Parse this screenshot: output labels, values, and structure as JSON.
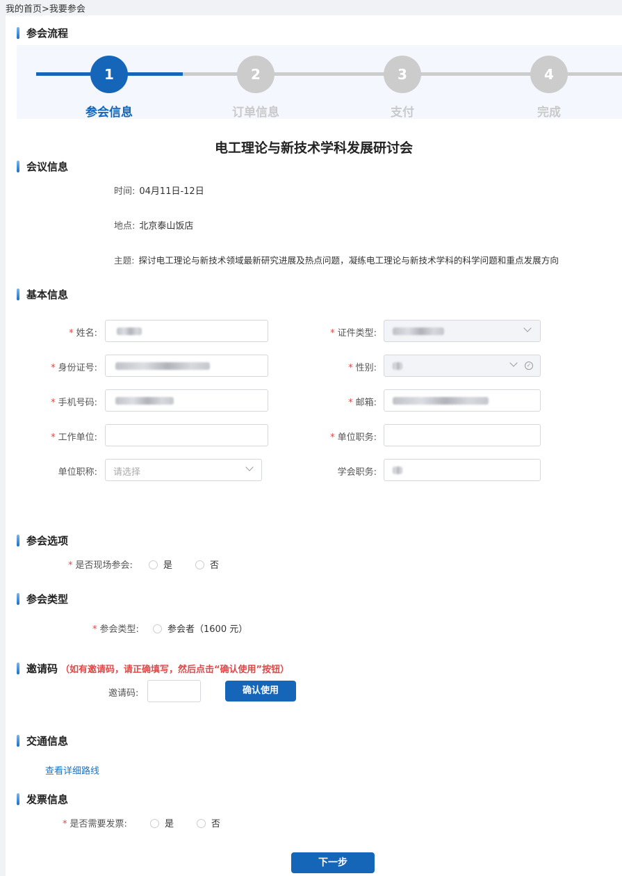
{
  "breadcrumb": "我的首页>我要参会",
  "sections": {
    "flow": "参会流程",
    "meeting": "会议信息",
    "basic": "基本信息",
    "options": "参会选项",
    "type": "参会类型",
    "invite": "邀请码",
    "invite_hint": "（如有邀请码，请正确填写，然后点击“确认使用”按钮）",
    "traffic": "交通信息",
    "invoice": "发票信息"
  },
  "steps": [
    {
      "num": "1",
      "label": "参会信息"
    },
    {
      "num": "2",
      "label": "订单信息"
    },
    {
      "num": "3",
      "label": "支付"
    },
    {
      "num": "4",
      "label": "完成"
    }
  ],
  "colors": {
    "active": "#1565b8",
    "inactive": "#c9c9c9",
    "required": "#e04848"
  },
  "conference_title": "电工理论与新技术学科发展研讨会",
  "meeting": {
    "time_label": "时间:",
    "time": "04月11日-12日",
    "place_label": "地点:",
    "place": "北京泰山饭店",
    "topic_label": "主题:",
    "topic": "探讨电工理论与新技术领域最新研究进展及热点问题，凝练电工理论与新技术学科的科学问题和重点发展方向"
  },
  "form": {
    "name_label": "姓名:",
    "id_type_label": "证件类型:",
    "id_no_label": "身份证号:",
    "gender_label": "性别:",
    "phone_label": "手机号码:",
    "email_label": "邮箱:",
    "company_label": "工作单位:",
    "position_label": "单位职务:",
    "title_label": "单位职称:",
    "title_placeholder": "请选择",
    "society_label": "学会职务:"
  },
  "options": {
    "onsite_label": "是否现场参会:",
    "yes": "是",
    "no": "否"
  },
  "type": {
    "label": "参会类型:",
    "attendee": "参会者（1600 元）"
  },
  "invite": {
    "label": "邀请码:",
    "confirm": "确认使用"
  },
  "traffic": {
    "link": "查看详细路线"
  },
  "invoice": {
    "need_label": "是否需要发票:",
    "yes": "是",
    "no": "否"
  },
  "next_button": "下一步"
}
